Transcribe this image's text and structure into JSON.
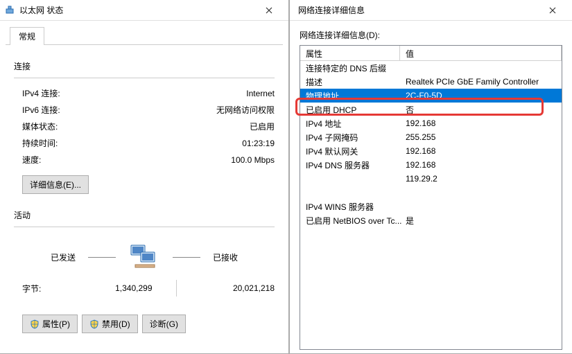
{
  "left": {
    "title": "以太网 状态",
    "tab": "常规",
    "connection": {
      "heading": "连接",
      "rows": [
        {
          "label": "IPv4 连接:",
          "value": "Internet"
        },
        {
          "label": "IPv6 连接:",
          "value": "无网络访问权限"
        },
        {
          "label": "媒体状态:",
          "value": "已启用"
        },
        {
          "label": "持续时间:",
          "value": "01:23:19"
        },
        {
          "label": "速度:",
          "value": "100.0 Mbps"
        }
      ],
      "details_btn": "详细信息(E)..."
    },
    "activity": {
      "heading": "活动",
      "sent_label": "已发送",
      "received_label": "已接收",
      "bytes_label": "字节:",
      "bytes_sent": "1,340,299",
      "bytes_received": "20,021,218"
    },
    "buttons": {
      "properties": "属性(P)",
      "disable": "禁用(D)",
      "diagnose": "诊断(G)"
    }
  },
  "right": {
    "title": "网络连接详细信息",
    "list_label": "网络连接详细信息(D):",
    "columns": {
      "property": "属性",
      "value": "值"
    },
    "rows": [
      {
        "p": "连接特定的 DNS 后缀",
        "v": ""
      },
      {
        "p": "描述",
        "v": "Realtek PCIe GbE Family Controller"
      },
      {
        "p": "物理地址",
        "v": "2C-F0-5D",
        "selected": true
      },
      {
        "p": "已启用 DHCP",
        "v": "否"
      },
      {
        "p": "IPv4 地址",
        "v": "192.168"
      },
      {
        "p": "IPv4 子网掩码",
        "v": "255.255"
      },
      {
        "p": "IPv4 默认网关",
        "v": "192.168"
      },
      {
        "p": "IPv4 DNS 服务器",
        "v": "192.168"
      },
      {
        "p": "",
        "v": "119.29.2"
      },
      {
        "p": "IPv4 WINS 服务器",
        "v": ""
      },
      {
        "p": "已启用 NetBIOS over Tc...",
        "v": "是"
      }
    ]
  }
}
